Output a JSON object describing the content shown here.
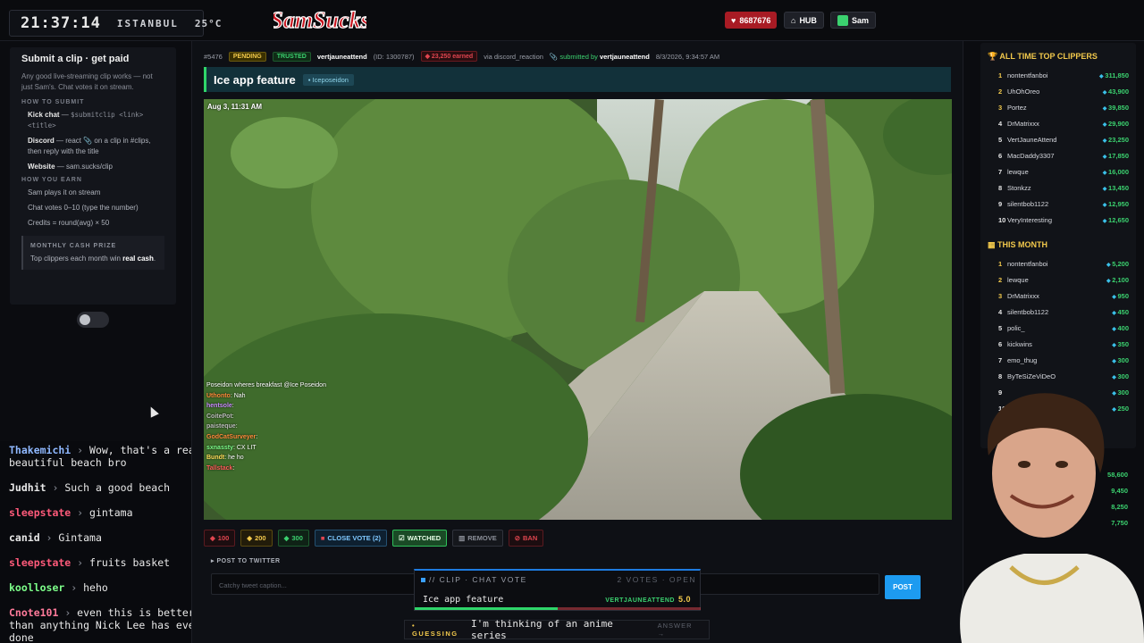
{
  "topbar": {
    "clock": "21:37:14",
    "city": "ISTANBUL",
    "temp": "25°C",
    "logo_text": "SamSucks",
    "gems": "8687676",
    "hub_label": "HUB",
    "user_label": "Sam"
  },
  "left": {
    "title": "Submit a clip · get paid",
    "desc": "Any good live-streaming clip works — not just Sam's. Chat votes it on stream.",
    "how_submit_h": "HOW TO SUBMIT",
    "kick_label": "Kick chat",
    "kick_dash": " — ",
    "kick_code": "$submitclip <link> <title>",
    "discord_label": "Discord",
    "discord_text": " — react 📎 on a clip in #clips, then reply with the title",
    "website_label": "Website",
    "website_text": " — sam.sucks/clip",
    "how_earn_h": "HOW YOU EARN",
    "earn1": "Sam plays it on stream",
    "earn2": "Chat votes 0–10 (type the number)",
    "earn3": "Credits = round(avg) × 50",
    "prize_h": "MONTHLY CASH PRIZE",
    "prize_text_a": "Top clippers each month win ",
    "prize_text_b": "real cash",
    "prize_text_c": "."
  },
  "chat": [
    {
      "user": "Thakemichi",
      "color": "#8fb8ff",
      "text": "Wow, that's a really beautiful beach bro"
    },
    {
      "user": "Judhit",
      "color": "#e8e8e8",
      "text": "Such a good beach"
    },
    {
      "user": "sleepstate",
      "color": "#ff5a7a",
      "text": "gintama"
    },
    {
      "user": "canid",
      "color": "#e8e8e8",
      "text": "Gintama"
    },
    {
      "user": "sleepstate",
      "color": "#ff5a7a",
      "text": "fruits basket"
    },
    {
      "user": "koolloser",
      "color": "#7dff8a",
      "text": "heho"
    },
    {
      "user": "Cnote101",
      "color": "#ff7a9a",
      "text": "even this is better than anything Nick Lee has ever done"
    }
  ],
  "meta": {
    "id": "#5476",
    "pending": "PENDING",
    "trusted": "TRUSTED",
    "user": "vertjauneattend",
    "user_id": "(ID: 1300787)",
    "earned": "23,250 earned",
    "via": "via discord_reaction",
    "submitted_prefix": "submitted by",
    "submitted_user": "vertjauneattend",
    "date": "8/3/2026, 9:34:57 AM"
  },
  "clip": {
    "title": "Ice app feature",
    "chip": "Iceposeidon",
    "timestamp": "Aug 3, 11:31 AM"
  },
  "overlay_chat": [
    {
      "user": "",
      "text": "Poseidon wheres breakfast @Ice Poseidon",
      "color": "#ffffff"
    },
    {
      "user": "Uthonto",
      "text": ": Nah",
      "color": "#ff8a3a"
    },
    {
      "user": "hentsole",
      "text": ":",
      "color": "#c98aff"
    },
    {
      "user": "CoitePot",
      "text": ":",
      "color": "#bbbbbb"
    },
    {
      "user": "paisteque",
      "text": ":",
      "color": "#bbbbbb"
    },
    {
      "user": "GodCatSurveyer",
      "text": ":",
      "color": "#ff8a3a"
    },
    {
      "user": "sxnassty",
      "text": ": CX LIT",
      "color": "#7dff8a"
    },
    {
      "user": "Bundt",
      "text": ": he ho",
      "color": "#ffdf5a"
    },
    {
      "user": "Tallstack",
      "text": ":",
      "color": "#ff5a5a"
    }
  ],
  "actions": {
    "v100": "100",
    "v200": "200",
    "v300": "300",
    "close": "CLOSE VOTE (2)",
    "watched": "WATCHED",
    "remove": "REMOVE",
    "ban": "BAN"
  },
  "twitter": {
    "heading": "POST TO TWITTER",
    "placeholder": "Catchy tweet caption...",
    "post": "POST"
  },
  "vote": {
    "head": "// CLIP · CHAT VOTE",
    "votes": "2 VOTES · OPEN",
    "title": "Ice app feature",
    "user": "VERTJAUNEATTEND",
    "score": "5.0"
  },
  "guess": {
    "label": "GUESSING",
    "text": "I'm thinking of an anime series",
    "answer": "ANSWER →"
  },
  "leaderboard": {
    "all_time_h": "ALL TIME TOP CLIPPERS",
    "all_time": [
      {
        "rank": "1",
        "name": "nontentfanboi",
        "value": "311,850"
      },
      {
        "rank": "2",
        "name": "UhOhOreo",
        "value": "43,900"
      },
      {
        "rank": "3",
        "name": "Portez",
        "value": "39,850"
      },
      {
        "rank": "4",
        "name": "DrMatrixxx",
        "value": "29,900"
      },
      {
        "rank": "5",
        "name": "VertJauneAttend",
        "value": "23,250"
      },
      {
        "rank": "6",
        "name": "MacDaddy3307",
        "value": "17,850"
      },
      {
        "rank": "7",
        "name": "lewque",
        "value": "16,000"
      },
      {
        "rank": "8",
        "name": "Stonkzz",
        "value": "13,450"
      },
      {
        "rank": "9",
        "name": "silentbob1122",
        "value": "12,950"
      },
      {
        "rank": "10",
        "name": "VeryInteresting",
        "value": "12,650"
      }
    ],
    "month_h": "THIS MONTH",
    "month": [
      {
        "rank": "1",
        "name": "nontentfanboi",
        "value": "5,200"
      },
      {
        "rank": "2",
        "name": "lewque",
        "value": "2,100"
      },
      {
        "rank": "3",
        "name": "DrMatrixxx",
        "value": "950"
      },
      {
        "rank": "4",
        "name": "silentbob1122",
        "value": "450"
      },
      {
        "rank": "5",
        "name": "polic_",
        "value": "400"
      },
      {
        "rank": "6",
        "name": "kickwins",
        "value": "350"
      },
      {
        "rank": "7",
        "name": "emo_thug",
        "value": "300"
      },
      {
        "rank": "8",
        "name": "ByTeSiZeViDeO",
        "value": "300"
      },
      {
        "rank": "9",
        "name": "",
        "value": "300"
      },
      {
        "rank": "10",
        "name": "",
        "value": "250"
      }
    ],
    "lower_values": [
      "58,600",
      "9,450",
      "8,250",
      "7,750"
    ]
  },
  "colors": {
    "accent_green": "#2fd56a",
    "accent_red": "#a81b24",
    "gold": "#f2c94c",
    "twitter_blue": "#1d9bf0"
  }
}
